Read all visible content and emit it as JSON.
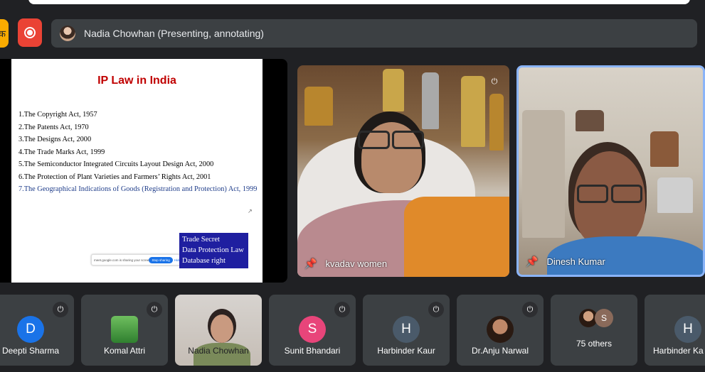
{
  "presenter_bar": {
    "text": "Nadia Chowhan (Presenting, annotating)",
    "yellow_glyph": "क"
  },
  "slide": {
    "title": "IP Law in India",
    "items": [
      "1.The Copyright Act, 1957",
      "2.The Patents Act, 1970",
      "3.The Designs Act, 2000",
      "4.The Trade Marks Act, 1999",
      "5.The Semiconductor Integrated Circuits Layout Design Act, 2000",
      "6.The Protection of Plant Varieties and Farmers’ Rights Act, 2001",
      "7.The Geographical Indications of Goods (Registration and Protection) Act, 1999"
    ],
    "box_lines": [
      "Trade Secret",
      "Data Protection Law",
      "Database right"
    ],
    "share_notice": "meet.google.com is sharing your screen.",
    "stop_label": "Stop sharing",
    "hide_label": "Hide"
  },
  "videos": [
    {
      "name": "kvadav women"
    },
    {
      "name": "Dinesh Kumar"
    }
  ],
  "participants": [
    {
      "name": "Deepti Sharma",
      "initial": "D",
      "color": "#1a73e8",
      "muted": true
    },
    {
      "name": "Komal Attri",
      "initial": "",
      "color": "#3c8c3c",
      "muted": true
    },
    {
      "name": "Nadia Chowhan",
      "initial": "",
      "color": "",
      "muted": false
    },
    {
      "name": "Sunit Bhandari",
      "initial": "S",
      "color": "#e8457a",
      "muted": true
    },
    {
      "name": "Harbinder Kaur",
      "initial": "H",
      "color": "#4a5a6a",
      "muted": true
    },
    {
      "name": "Dr.Anju Narwal",
      "initial": "",
      "color": "#7a4a2a",
      "muted": true
    },
    {
      "name": "75 others",
      "initial": "S",
      "color": "#8a6a5a",
      "muted": false
    },
    {
      "name": "Harbinder Ka",
      "initial": "H",
      "color": "#4a5a6a",
      "muted": false
    }
  ]
}
